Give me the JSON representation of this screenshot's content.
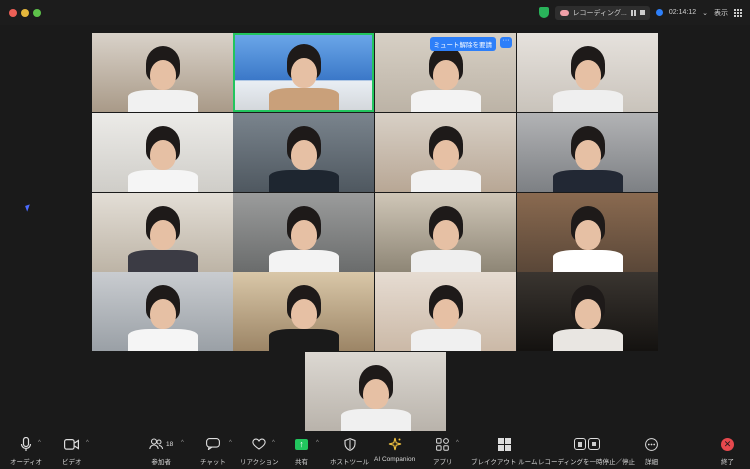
{
  "titlebar": {
    "recording_label": "レコーディング...",
    "timer": "02:14:12",
    "view_label": "表示"
  },
  "video_tiles": [
    {
      "label": "participant-1"
    },
    {
      "label": "participant-2"
    },
    {
      "label": "participant-3"
    },
    {
      "label": "participant-4"
    },
    {
      "label": "participant-5"
    },
    {
      "label": "participant-6"
    },
    {
      "label": "participant-7"
    },
    {
      "label": "participant-8"
    },
    {
      "label": "participant-9"
    },
    {
      "label": "participant-10"
    },
    {
      "label": "participant-11"
    },
    {
      "label": "participant-12"
    },
    {
      "label": "participant-13"
    },
    {
      "label": "participant-14"
    },
    {
      "label": "participant-15"
    },
    {
      "label": "participant-16"
    },
    {
      "label": "participant-17"
    }
  ],
  "tile_controls": {
    "unmute_request_label": "ミュート解除を要請",
    "more_label": "···"
  },
  "toolbar": {
    "audio_label": "オーディオ",
    "video_label": "ビデオ",
    "participants_label": "参加者",
    "participants_count": "18",
    "chat_label": "チャット",
    "reactions_label": "リアクション",
    "share_label": "共有",
    "host_tools_label": "ホストツール",
    "ai_companion_label": "AI Companion",
    "apps_label": "アプリ",
    "breakout_label": "ブレイクアウト ルーム",
    "recording_control_label": "レコーディングを一時停止／停止",
    "details_label": "詳細",
    "end_label": "終了"
  },
  "colors": {
    "accent_blue": "#2d7ff9",
    "share_green": "#22c55e",
    "end_red": "#e5484d",
    "active_speaker_border": "#22c55e"
  }
}
